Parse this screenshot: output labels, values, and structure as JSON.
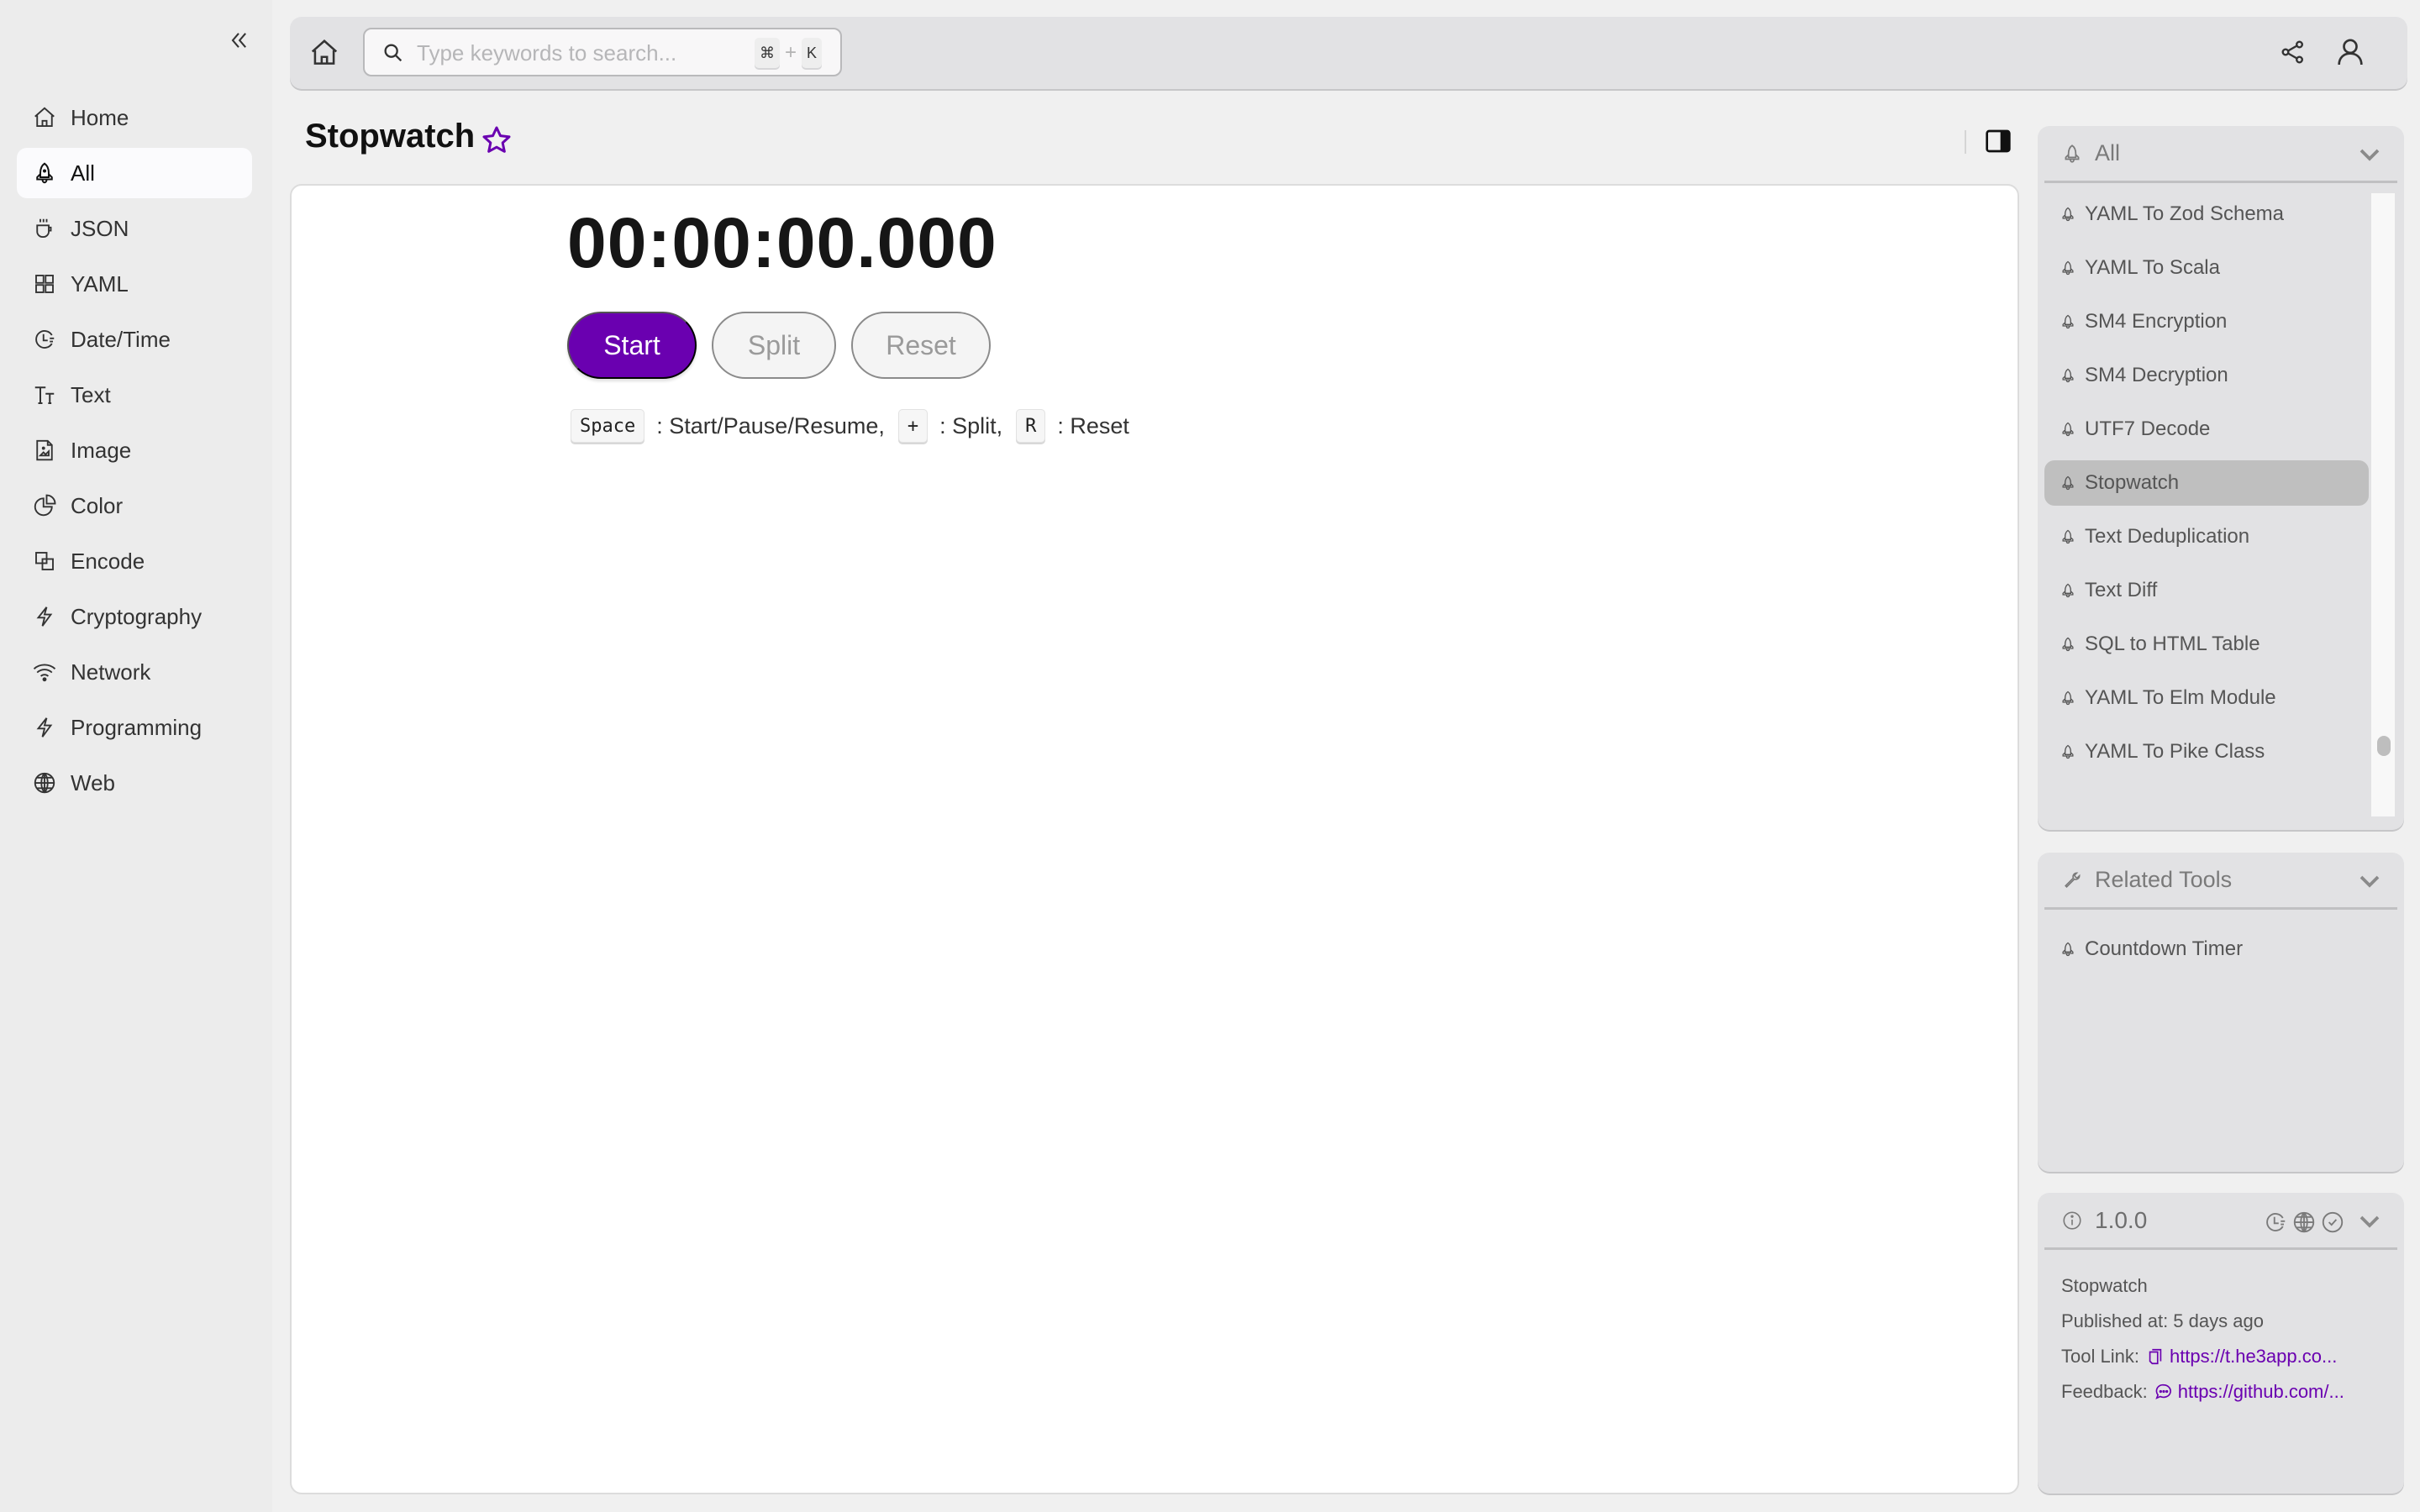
{
  "sidebar": {
    "items": [
      {
        "label": "Home",
        "icon": "home-icon",
        "active": false
      },
      {
        "label": "All",
        "icon": "rocket-icon",
        "active": true
      },
      {
        "label": "JSON",
        "icon": "coffee-cup-icon",
        "active": false
      },
      {
        "label": "YAML",
        "icon": "grid-icon",
        "active": false
      },
      {
        "label": "Date/Time",
        "icon": "clock-icon",
        "active": false
      },
      {
        "label": "Text",
        "icon": "text-size-icon",
        "active": false
      },
      {
        "label": "Image",
        "icon": "image-file-icon",
        "active": false
      },
      {
        "label": "Color",
        "icon": "pie-chart-icon",
        "active": false
      },
      {
        "label": "Encode",
        "icon": "overlap-squares-icon",
        "active": false
      },
      {
        "label": "Cryptography",
        "icon": "lightning-icon",
        "active": false
      },
      {
        "label": "Network",
        "icon": "wifi-icon",
        "active": false
      },
      {
        "label": "Programming",
        "icon": "lightning-icon",
        "active": false
      },
      {
        "label": "Web",
        "icon": "globe-icon",
        "active": false
      }
    ]
  },
  "topbar": {
    "search_placeholder": "Type keywords to search...",
    "search_value": "",
    "shortcut_mod": "⌘",
    "shortcut_plus": "+",
    "shortcut_key": "K"
  },
  "page": {
    "title": "Stopwatch",
    "favorited": false
  },
  "stopwatch": {
    "time": "00:00:00.000",
    "start_label": "Start",
    "split_label": "Split",
    "reset_label": "Reset",
    "hints": [
      {
        "key": "Space",
        "text": ": Start/Pause/Resume,"
      },
      {
        "key": "+",
        "text": ": Split,"
      },
      {
        "key": "R",
        "text": ": Reset"
      }
    ]
  },
  "all_panel": {
    "title": "All",
    "items": [
      {
        "label": "YAML To Zod Schema",
        "active": false
      },
      {
        "label": "YAML To Scala",
        "active": false
      },
      {
        "label": "SM4 Encryption",
        "active": false
      },
      {
        "label": "SM4 Decryption",
        "active": false
      },
      {
        "label": "UTF7 Decode",
        "active": false
      },
      {
        "label": "Stopwatch",
        "active": true
      },
      {
        "label": "Text Deduplication",
        "active": false
      },
      {
        "label": "Text Diff",
        "active": false
      },
      {
        "label": "SQL to HTML Table",
        "active": false
      },
      {
        "label": "YAML To Elm Module",
        "active": false
      },
      {
        "label": "YAML To Pike Class",
        "active": false
      }
    ]
  },
  "related_panel": {
    "title": "Related Tools",
    "items": [
      {
        "label": "Countdown Timer"
      }
    ]
  },
  "info_panel": {
    "version": "1.0.0",
    "name": "Stopwatch",
    "published": "Published at: 5 days ago",
    "tool_link_label": "Tool Link:",
    "tool_link": "https://t.he3app.co...",
    "feedback_label": "Feedback:",
    "feedback_link": "https://github.com/..."
  },
  "colors": {
    "accent": "#6a00b0",
    "background": "#f0f0f0",
    "panel": "#e2e2e4"
  }
}
